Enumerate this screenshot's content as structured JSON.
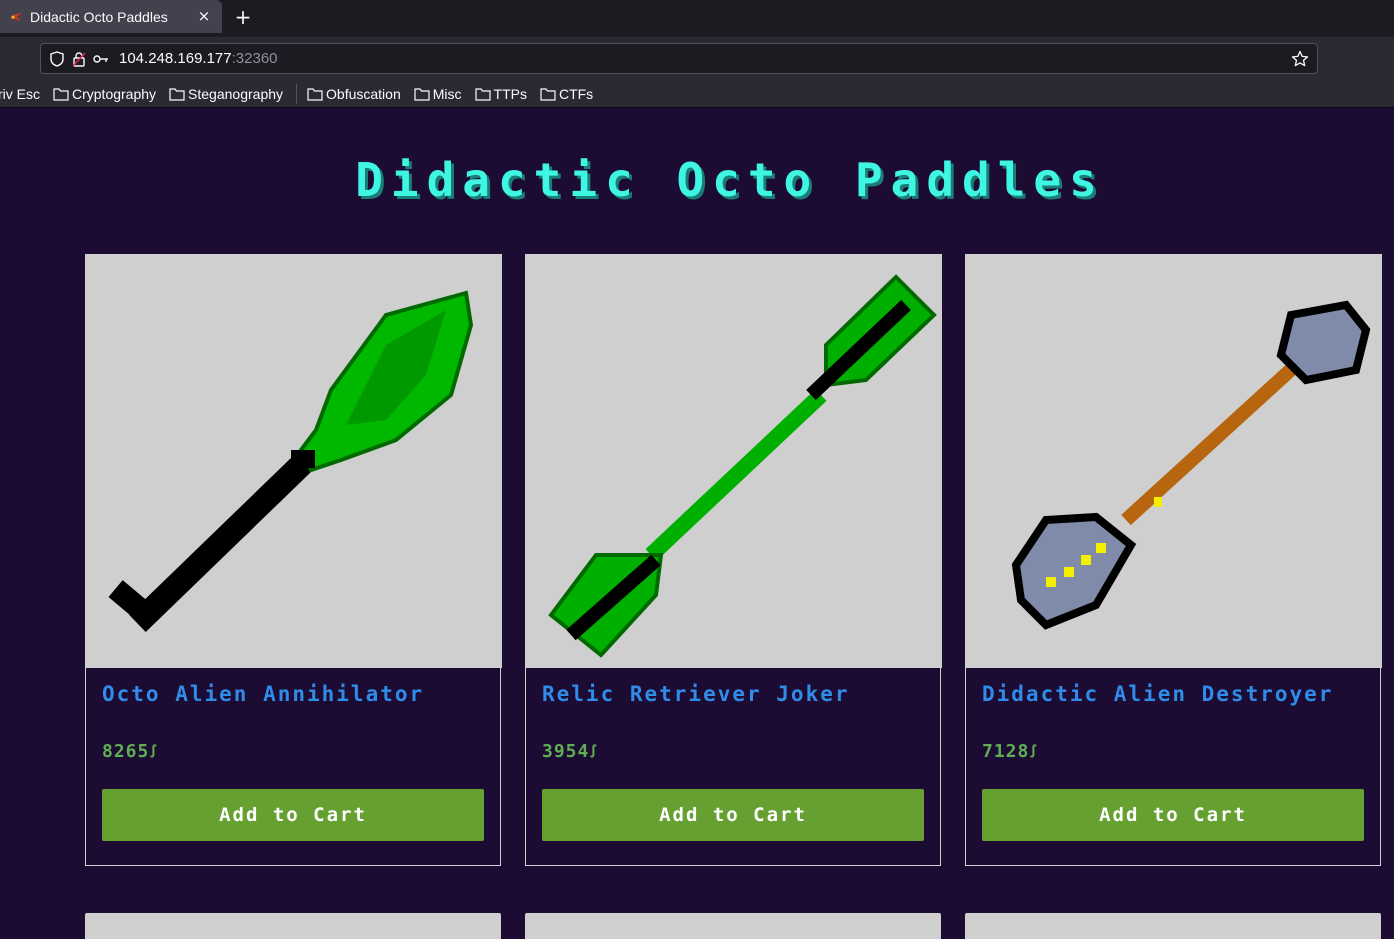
{
  "browser": {
    "tab_title": "Didactic Octo Paddles",
    "close_glyph": "×",
    "newtab_glyph": "+",
    "url_host": "104.248.169.177",
    "url_port": ":32360",
    "bookmarks": [
      "riv Esc",
      "Cryptography",
      "Steganography",
      "Obfuscation",
      "Misc",
      "TTPs",
      "CTFs"
    ]
  },
  "page": {
    "title": "Didactic Octo Paddles",
    "products": [
      {
        "name": "Octo Alien Annihilator",
        "price": "8265",
        "currency": "ꭍ",
        "button": "Add to Cart",
        "paddle": "green-black-paddle"
      },
      {
        "name": "Relic Retriever Joker",
        "price": "3954",
        "currency": "ꭍ",
        "button": "Add to Cart",
        "paddle": "green-double-paddle"
      },
      {
        "name": "Didactic Alien Destroyer",
        "price": "7128",
        "currency": "ꭍ",
        "button": "Add to Cart",
        "paddle": "gray-yellow-paddle"
      }
    ]
  },
  "colors": {
    "page_bg": "#1c0b33",
    "title": "#3ff6e2",
    "product_name": "#2f8ce8",
    "price": "#5fae52",
    "button": "#66a030"
  }
}
